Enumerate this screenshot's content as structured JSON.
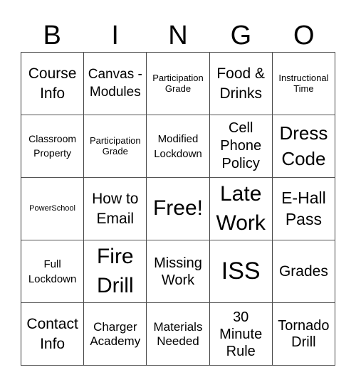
{
  "header": {
    "letters": [
      "B",
      "I",
      "N",
      "G",
      "O"
    ]
  },
  "grid": {
    "rows": [
      [
        {
          "text": "Course Info",
          "size": "lg"
        },
        {
          "text": "Canvas - Modules",
          "size": "md-tall"
        },
        {
          "text": "Participation Grade",
          "size": "xs"
        },
        {
          "text": "Food & Drinks",
          "size": "lg"
        },
        {
          "text": "Instructional Time",
          "size": "xs"
        }
      ],
      [
        {
          "text": "Classroom Property",
          "size": "sm"
        },
        {
          "text": "Participation Grade",
          "size": "xs"
        },
        {
          "text": "Modified Lockdown",
          "size": "sm"
        },
        {
          "text": "Cell Phone Policy",
          "size": "md"
        },
        {
          "text": "Dress Code",
          "size": "xl"
        }
      ],
      [
        {
          "text": "PowerSchool",
          "size": "xs"
        },
        {
          "text": "How to Email",
          "size": "lg"
        },
        {
          "text": "Free!",
          "size": "xxl"
        },
        {
          "text": "Late Work",
          "size": "xxl"
        },
        {
          "text": "E-Hall Pass",
          "size": "lg"
        }
      ],
      [
        {
          "text": "Full Lockdown",
          "size": "sm"
        },
        {
          "text": "Fire Drill",
          "size": "xxl"
        },
        {
          "text": "Missing Work",
          "size": "md"
        },
        {
          "text": "ISS",
          "size": "xxl"
        },
        {
          "text": "Grades",
          "size": "lg"
        }
      ],
      [
        {
          "text": "Contact Info",
          "size": "lg"
        },
        {
          "text": "Charger Academy",
          "size": "md"
        },
        {
          "text": "Materials Needed",
          "size": "md"
        },
        {
          "text": "30 Minute Rule",
          "size": "md"
        },
        {
          "text": "Tornado Drill",
          "size": "md"
        }
      ]
    ]
  }
}
